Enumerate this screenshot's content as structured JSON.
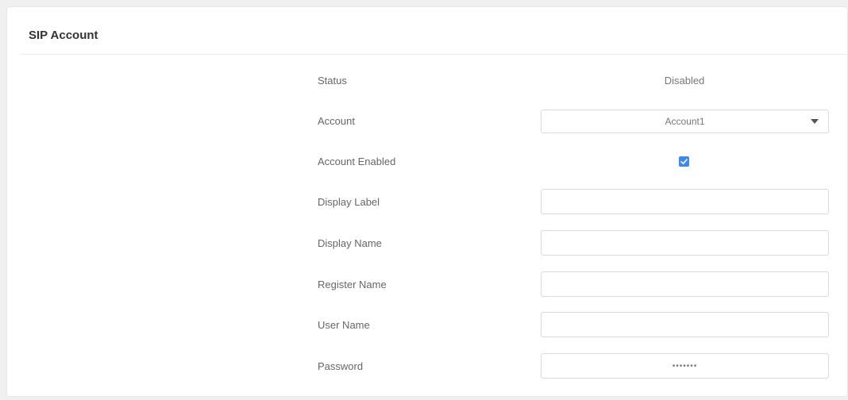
{
  "panel": {
    "title": "SIP Account"
  },
  "status": {
    "label": "Status",
    "value": "Disabled"
  },
  "account": {
    "label": "Account",
    "selected": "Account1"
  },
  "account_enabled": {
    "label": "Account Enabled",
    "checked": true
  },
  "display_label": {
    "label": "Display Label",
    "value": ""
  },
  "display_name": {
    "label": "Display Name",
    "value": ""
  },
  "register_name": {
    "label": "Register Name",
    "value": ""
  },
  "user_name": {
    "label": "User Name",
    "value": ""
  },
  "password": {
    "label": "Password",
    "value": "•••••••"
  },
  "colors": {
    "accent": "#3c8bea",
    "border": "#d9d9d9",
    "label_text": "#666666"
  }
}
